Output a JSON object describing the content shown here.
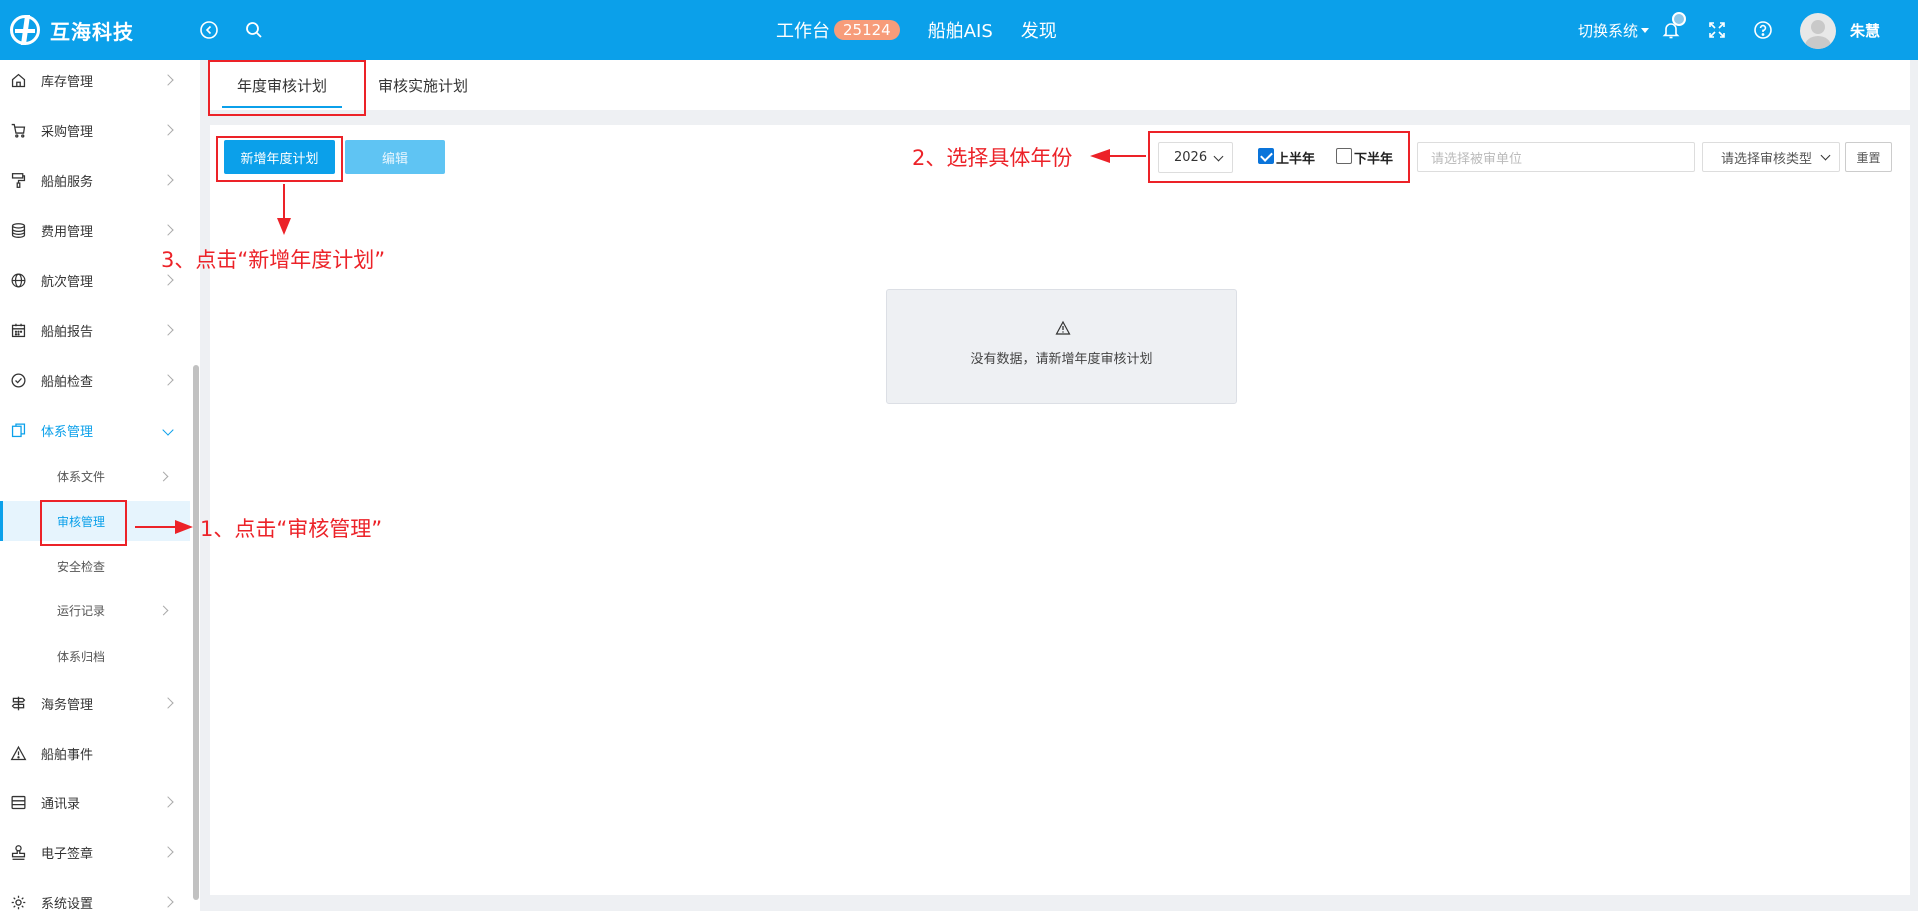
{
  "header": {
    "logo_text": "互海科技",
    "nav": [
      {
        "label": "工作台",
        "badge": "25124"
      },
      {
        "label": "船舶AIS"
      },
      {
        "label": "发现"
      }
    ],
    "switch_system_label": "切换系统",
    "username": "朱慧"
  },
  "sidebar": {
    "items": [
      {
        "label": "库存管理",
        "icon": "home-icon"
      },
      {
        "label": "采购管理",
        "icon": "cart-icon"
      },
      {
        "label": "船舶服务",
        "icon": "paint-roller-icon"
      },
      {
        "label": "费用管理",
        "icon": "database-icon"
      },
      {
        "label": "航次管理",
        "icon": "globe-icon"
      },
      {
        "label": "船舶报告",
        "icon": "calendar-icon"
      },
      {
        "label": "船舶检查",
        "icon": "check-circle-icon"
      },
      {
        "label": "体系管理",
        "icon": "copy-icon"
      },
      {
        "label": "海务管理",
        "icon": "signpost-icon"
      },
      {
        "label": "船舶事件",
        "icon": "warning-icon"
      },
      {
        "label": "通讯录",
        "icon": "contacts-icon"
      },
      {
        "label": "电子签章",
        "icon": "stamp-icon"
      },
      {
        "label": "系统设置",
        "icon": "gear-icon"
      }
    ],
    "sub_items": [
      {
        "label": "体系文件"
      },
      {
        "label": "审核管理"
      },
      {
        "label": "安全检查"
      },
      {
        "label": "运行记录"
      },
      {
        "label": "体系归档"
      }
    ]
  },
  "tabs": [
    {
      "label": "年度审核计划"
    },
    {
      "label": "审核实施计划"
    }
  ],
  "toolbar": {
    "add_label": "新增年度计划",
    "edit_label": "编辑",
    "year_value": "2026",
    "first_half_label": "上半年",
    "first_half_checked": true,
    "second_half_label": "下半年",
    "second_half_checked": false,
    "unit_placeholder": "请选择被审单位",
    "type_placeholder": "请选择审核类型",
    "reset_label": "重置"
  },
  "empty_state": {
    "message": "没有数据，请新增年度审核计划"
  },
  "annotations": {
    "step1": "1、点击“审核管理”",
    "step2": "2、选择具体年份",
    "step3": "3、点击“新增年度计划”",
    "color": "#ec2228"
  },
  "colors": {
    "brand": "#0ba0ea",
    "badge": "#f79c7a"
  }
}
